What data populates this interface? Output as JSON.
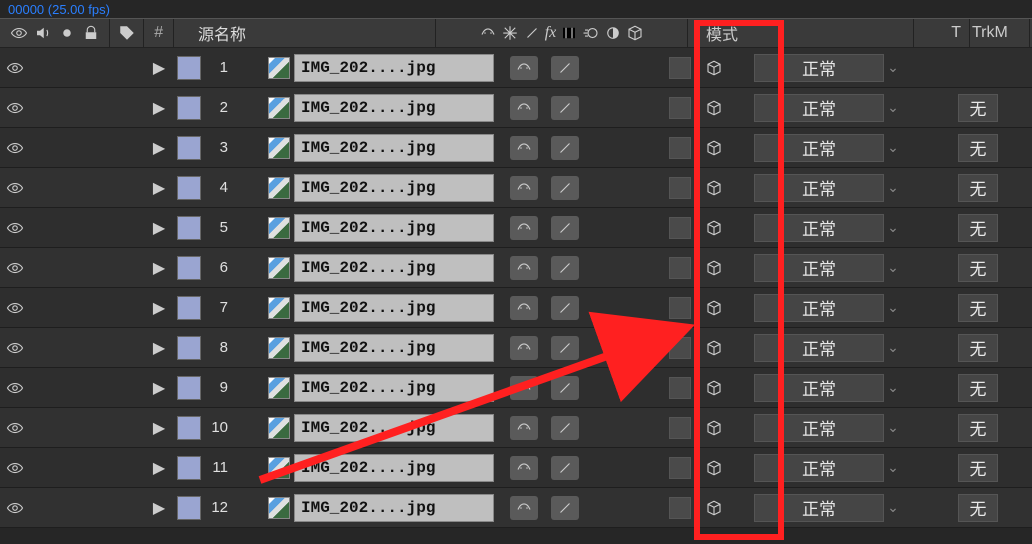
{
  "timecode": "00000 (25.00 fps)",
  "header": {
    "source_label": "源名称",
    "mode_label": "模式",
    "t_label": "T",
    "trk_label": "TrkM"
  },
  "layers": [
    {
      "index": 1,
      "name": "IMG_202....jpg",
      "mode": "正常",
      "trk": ""
    },
    {
      "index": 2,
      "name": "IMG_202....jpg",
      "mode": "正常",
      "trk": "无"
    },
    {
      "index": 3,
      "name": "IMG_202....jpg",
      "mode": "正常",
      "trk": "无"
    },
    {
      "index": 4,
      "name": "IMG_202....jpg",
      "mode": "正常",
      "trk": "无"
    },
    {
      "index": 5,
      "name": "IMG_202....jpg",
      "mode": "正常",
      "trk": "无"
    },
    {
      "index": 6,
      "name": "IMG_202....jpg",
      "mode": "正常",
      "trk": "无"
    },
    {
      "index": 7,
      "name": "IMG_202....jpg",
      "mode": "正常",
      "trk": "无"
    },
    {
      "index": 8,
      "name": "IMG_202....jpg",
      "mode": "正常",
      "trk": "无"
    },
    {
      "index": 9,
      "name": "IMG_202....jpg",
      "mode": "正常",
      "trk": "无"
    },
    {
      "index": 10,
      "name": "IMG_202....jpg",
      "mode": "正常",
      "trk": "无"
    },
    {
      "index": 11,
      "name": "IMG_202....jpg",
      "mode": "正常",
      "trk": "无"
    },
    {
      "index": 12,
      "name": "IMG_202....jpg",
      "mode": "正常",
      "trk": "无"
    }
  ]
}
